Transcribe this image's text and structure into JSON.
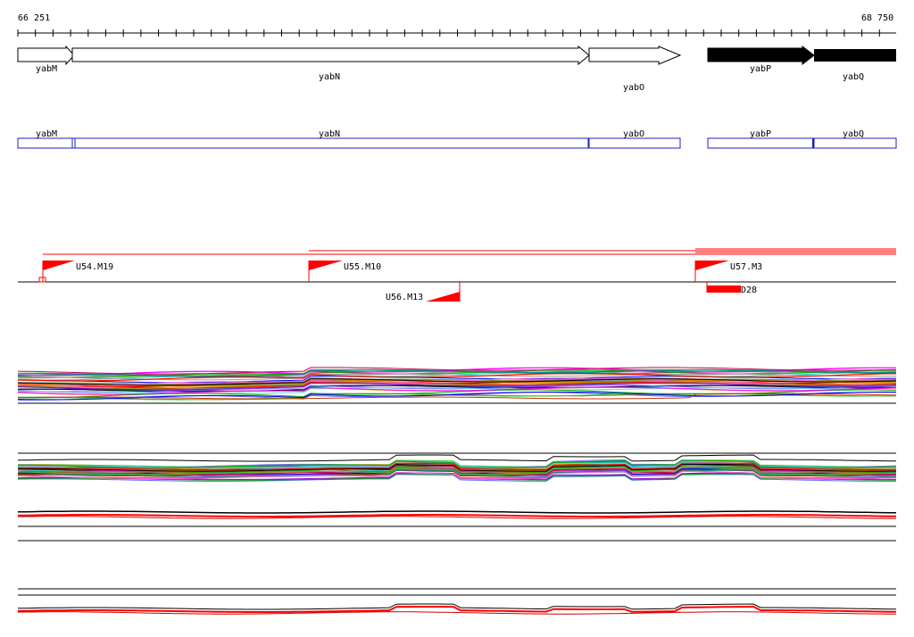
{
  "ruler": {
    "start_label": "66 251",
    "end_label": "68 750"
  },
  "genes": [
    {
      "name": "yabM",
      "strand": "forward",
      "filled": false
    },
    {
      "name": "yabN",
      "strand": "forward",
      "filled": false
    },
    {
      "name": "yabO",
      "strand": "forward",
      "filled": false
    },
    {
      "name": "yabP",
      "strand": "forward",
      "filled": true
    },
    {
      "name": "yabQ",
      "strand": "forward",
      "filled": true
    }
  ],
  "promoters": [
    {
      "name": "U54.M19",
      "strand": "forward"
    },
    {
      "name": "U55.M10",
      "strand": "forward"
    },
    {
      "name": "U56.M13",
      "strand": "reverse"
    },
    {
      "name": "U57.M3",
      "strand": "forward"
    }
  ],
  "terminators": [
    {
      "name": "D28"
    }
  ],
  "colors": {
    "gene_outline": "#000000",
    "gene_fill_dark": "#000000",
    "annotation_box": "#1f1fbf",
    "signal": "#ff0000",
    "baseline": "#000000"
  }
}
